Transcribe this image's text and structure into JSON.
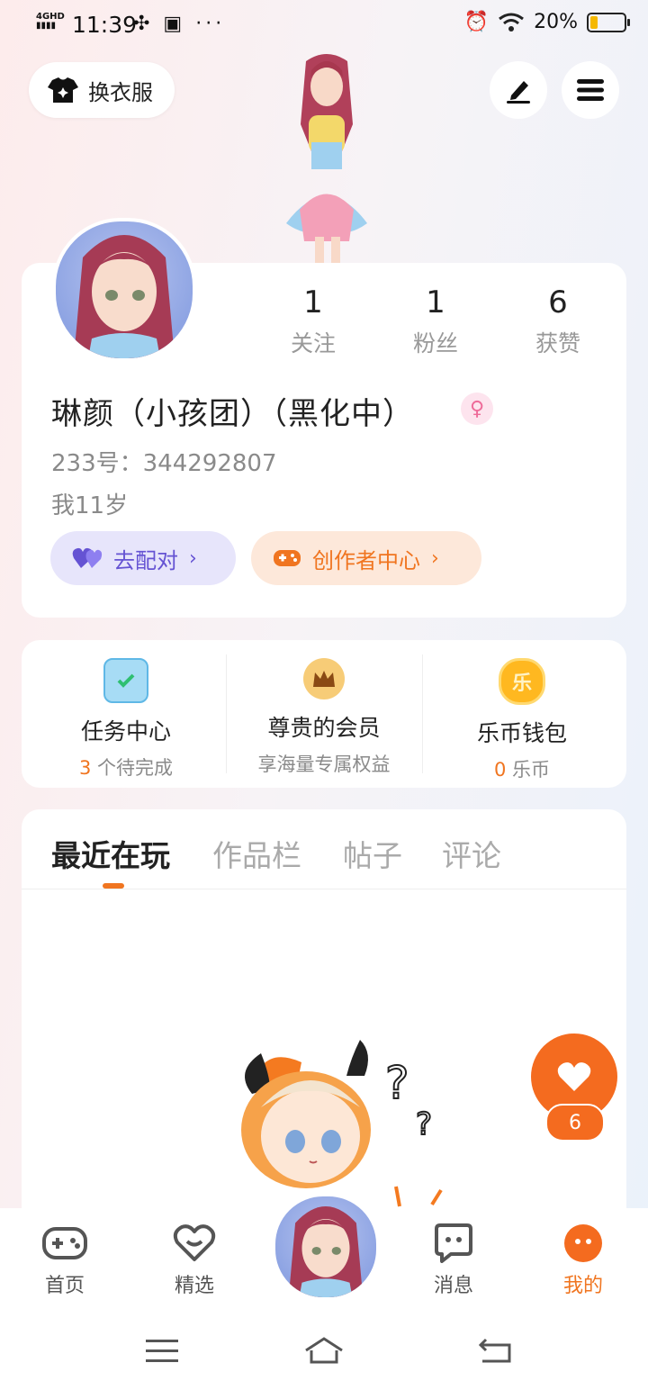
{
  "status_bar": {
    "network": "4GHD",
    "time": "11:39",
    "battery": "20%"
  },
  "top": {
    "outfit_label": "换衣服"
  },
  "profile": {
    "stats": [
      {
        "value": "1",
        "label": "关注"
      },
      {
        "value": "1",
        "label": "粉丝"
      },
      {
        "value": "6",
        "label": "获赞"
      }
    ],
    "username": "琳颜（小孩团）（黑化中）",
    "uid": "233号：344292807",
    "bio": "我11岁",
    "match_label": "去配对",
    "creator_label": "创作者中心"
  },
  "services": [
    {
      "title": "任务中心",
      "count": "3",
      "sub": " 个待完成"
    },
    {
      "title": "尊贵的会员",
      "count": "",
      "sub": "享海量专属权益"
    },
    {
      "title": "乐币钱包",
      "count": "0",
      "sub": " 乐币"
    }
  ],
  "tabs": [
    "最近在玩",
    "作品栏",
    "帖子",
    "评论"
  ],
  "fab": {
    "count": "6"
  },
  "bottom_nav": [
    "首页",
    "精选",
    "消息",
    "我的"
  ],
  "coin_icon_text": "乐",
  "colors": {
    "accent": "#f07520",
    "match": "#6553d3"
  }
}
